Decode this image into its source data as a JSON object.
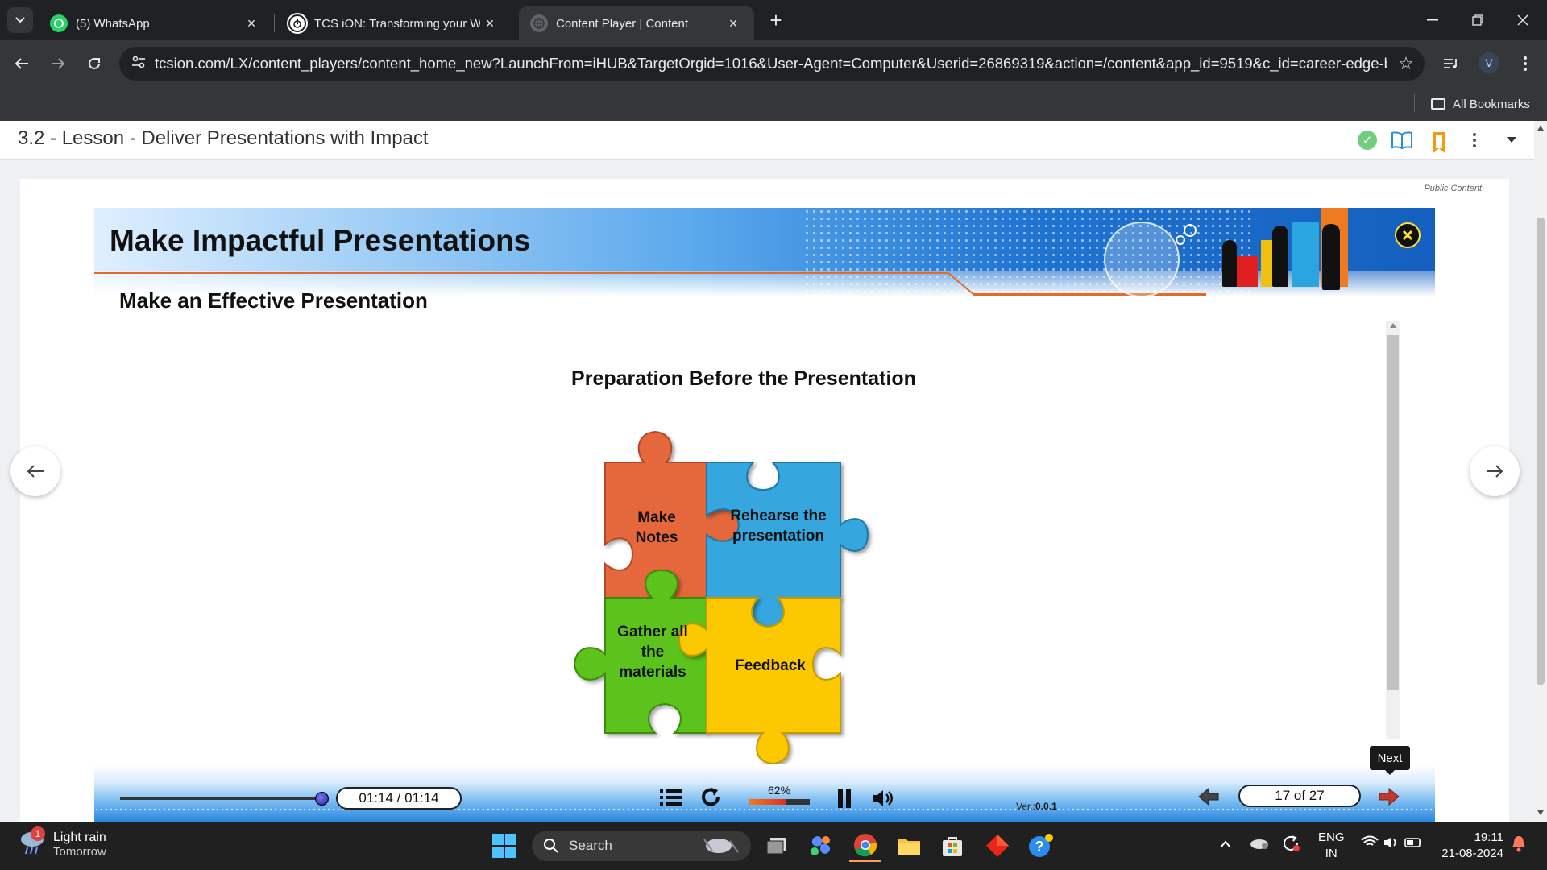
{
  "browser": {
    "tabs": [
      {
        "title": "(5) WhatsApp",
        "icon": "whatsapp-icon",
        "active": false
      },
      {
        "title": "TCS iON: Transforming your Wo",
        "icon": "tcs-ion-icon",
        "active": false
      },
      {
        "title": "Content Player | Content",
        "icon": "globe-icon",
        "active": true
      }
    ],
    "url": "tcsion.com/LX/content_players/content_home_new?LaunchFrom=iHUB&TargetOrgid=1016&User-Agent=Computer&Userid=26869319&action=/content&app_id=9519&c_id=career-edge-batch...",
    "avatar_letter": "V",
    "bookmarks_label": "All Bookmarks"
  },
  "lesson": {
    "title": "3.2 - Lesson - Deliver Presentations with Impact",
    "public_label": "Public Content"
  },
  "slide": {
    "title": "Make Impactful Presentations",
    "subtitle": "Make an Effective Presentation",
    "heading": "Preparation Before the Presentation",
    "pieces": {
      "top_left": "Make Notes",
      "top_right": "Rehearse the presentation",
      "bottom_left": "Gather all the materials",
      "bottom_right": "Feedback"
    },
    "colors": {
      "orange": "#e4683a",
      "blue": "#34a6de",
      "green": "#5cc21a",
      "yellow": "#fcc903"
    }
  },
  "player": {
    "time": "01:14 / 01:14",
    "progress": 1.0,
    "volume_label": "62%",
    "volume": 0.62,
    "version_prefix": "Ver.:",
    "version": "0.0.1",
    "page": "17 of 27",
    "next_tooltip": "Next"
  },
  "taskbar": {
    "weather_title": "Light rain",
    "weather_sub": "Tomorrow",
    "weather_badge": "1",
    "search": "Search",
    "lang_top": "ENG",
    "lang_bottom": "IN",
    "time": "19:11",
    "date": "21-08-2024"
  }
}
